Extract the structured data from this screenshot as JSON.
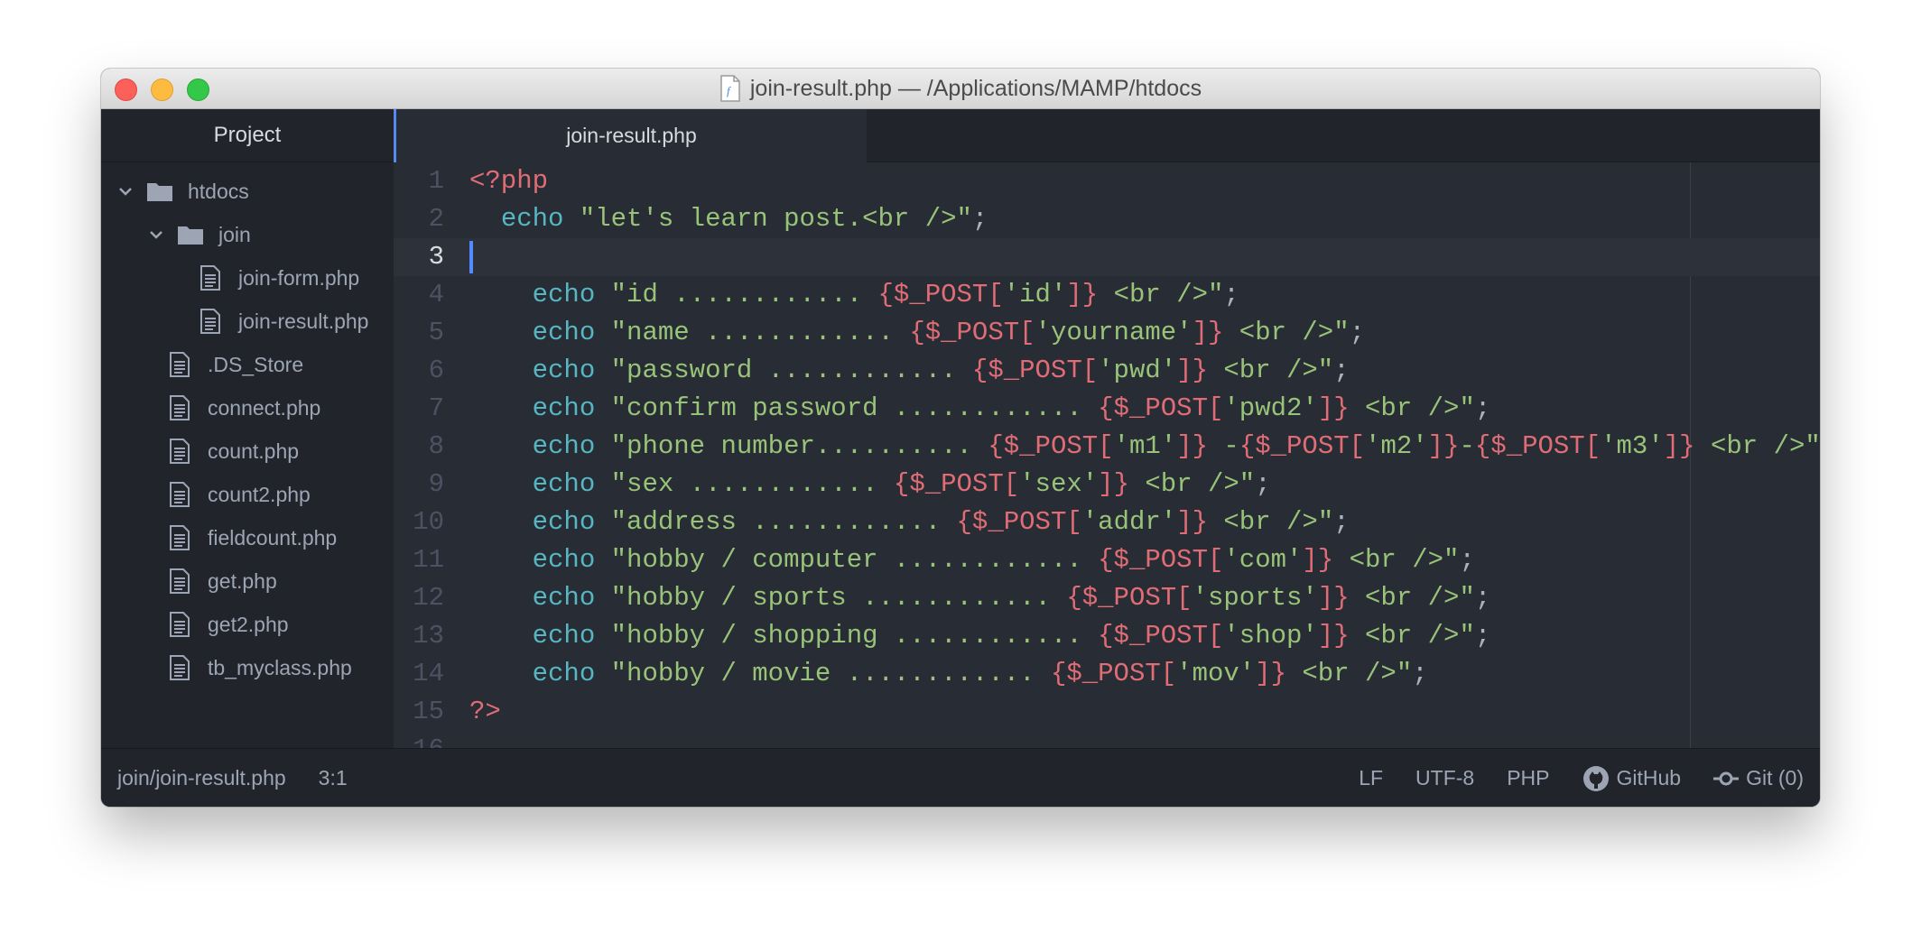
{
  "window": {
    "title": "join-result.php — /Applications/MAMP/htdocs"
  },
  "sidebar": {
    "tab_label": "Project",
    "tree": [
      {
        "label": "htdocs",
        "type": "folder",
        "depth": 0,
        "expanded": true
      },
      {
        "label": "join",
        "type": "folder",
        "depth": 1,
        "expanded": true
      },
      {
        "label": "join-form.php",
        "type": "file",
        "depth": 2
      },
      {
        "label": "join-result.php",
        "type": "file",
        "depth": 2
      },
      {
        "label": ".DS_Store",
        "type": "file",
        "depth": 1
      },
      {
        "label": "connect.php",
        "type": "file",
        "depth": 1
      },
      {
        "label": "count.php",
        "type": "file",
        "depth": 1
      },
      {
        "label": "count2.php",
        "type": "file",
        "depth": 1
      },
      {
        "label": "fieldcount.php",
        "type": "file",
        "depth": 1
      },
      {
        "label": "get.php",
        "type": "file",
        "depth": 1
      },
      {
        "label": "get2.php",
        "type": "file",
        "depth": 1
      },
      {
        "label": "tb_myclass.php",
        "type": "file",
        "depth": 1
      }
    ]
  },
  "editor": {
    "active_tab": "join-result.php",
    "cursor_line": 3,
    "lines": [
      [
        [
          "tag",
          "<?php"
        ]
      ],
      [
        [
          "pun",
          "  "
        ],
        [
          "kw",
          "echo"
        ],
        [
          "pun",
          " "
        ],
        [
          "str",
          "\"let's learn post.<br />\""
        ],
        [
          "pun",
          ";"
        ]
      ],
      [],
      [
        [
          "pun",
          "    "
        ],
        [
          "kw",
          "echo"
        ],
        [
          "pun",
          " "
        ],
        [
          "str",
          "\"id ............ "
        ],
        [
          "var",
          "{$_POST["
        ],
        [
          "str",
          "'id'"
        ],
        [
          "var",
          "]}"
        ],
        [
          "str",
          " <br />\""
        ],
        [
          "pun",
          ";"
        ]
      ],
      [
        [
          "pun",
          "    "
        ],
        [
          "kw",
          "echo"
        ],
        [
          "pun",
          " "
        ],
        [
          "str",
          "\"name ............ "
        ],
        [
          "var",
          "{$_POST["
        ],
        [
          "str",
          "'yourname'"
        ],
        [
          "var",
          "]}"
        ],
        [
          "str",
          " <br />\""
        ],
        [
          "pun",
          ";"
        ]
      ],
      [
        [
          "pun",
          "    "
        ],
        [
          "kw",
          "echo"
        ],
        [
          "pun",
          " "
        ],
        [
          "str",
          "\"password ............ "
        ],
        [
          "var",
          "{$_POST["
        ],
        [
          "str",
          "'pwd'"
        ],
        [
          "var",
          "]}"
        ],
        [
          "str",
          " <br />\""
        ],
        [
          "pun",
          ";"
        ]
      ],
      [
        [
          "pun",
          "    "
        ],
        [
          "kw",
          "echo"
        ],
        [
          "pun",
          " "
        ],
        [
          "str",
          "\"confirm password ............ "
        ],
        [
          "var",
          "{$_POST["
        ],
        [
          "str",
          "'pwd2'"
        ],
        [
          "var",
          "]}"
        ],
        [
          "str",
          " <br />\""
        ],
        [
          "pun",
          ";"
        ]
      ],
      [
        [
          "pun",
          "    "
        ],
        [
          "kw",
          "echo"
        ],
        [
          "pun",
          " "
        ],
        [
          "str",
          "\"phone number.......... "
        ],
        [
          "var",
          "{$_POST["
        ],
        [
          "str",
          "'m1'"
        ],
        [
          "var",
          "]}"
        ],
        [
          "str",
          " -"
        ],
        [
          "var",
          "{$_POST["
        ],
        [
          "str",
          "'m2'"
        ],
        [
          "var",
          "]}"
        ],
        [
          "str",
          "-"
        ],
        [
          "var",
          "{$_POST["
        ],
        [
          "str",
          "'m3'"
        ],
        [
          "var",
          "]}"
        ],
        [
          "str",
          " <br />\""
        ],
        [
          "pun",
          ";"
        ]
      ],
      [
        [
          "pun",
          "    "
        ],
        [
          "kw",
          "echo"
        ],
        [
          "pun",
          " "
        ],
        [
          "str",
          "\"sex ............ "
        ],
        [
          "var",
          "{$_POST["
        ],
        [
          "str",
          "'sex'"
        ],
        [
          "var",
          "]}"
        ],
        [
          "str",
          " <br />\""
        ],
        [
          "pun",
          ";"
        ]
      ],
      [
        [
          "pun",
          "    "
        ],
        [
          "kw",
          "echo"
        ],
        [
          "pun",
          " "
        ],
        [
          "str",
          "\"address ............ "
        ],
        [
          "var",
          "{$_POST["
        ],
        [
          "str",
          "'addr'"
        ],
        [
          "var",
          "]}"
        ],
        [
          "str",
          " <br />\""
        ],
        [
          "pun",
          ";"
        ]
      ],
      [
        [
          "pun",
          "    "
        ],
        [
          "kw",
          "echo"
        ],
        [
          "pun",
          " "
        ],
        [
          "str",
          "\"hobby / computer ............ "
        ],
        [
          "var",
          "{$_POST["
        ],
        [
          "str",
          "'com'"
        ],
        [
          "var",
          "]}"
        ],
        [
          "str",
          " <br />\""
        ],
        [
          "pun",
          ";"
        ]
      ],
      [
        [
          "pun",
          "    "
        ],
        [
          "kw",
          "echo"
        ],
        [
          "pun",
          " "
        ],
        [
          "str",
          "\"hobby / sports ............ "
        ],
        [
          "var",
          "{$_POST["
        ],
        [
          "str",
          "'sports'"
        ],
        [
          "var",
          "]}"
        ],
        [
          "str",
          " <br />\""
        ],
        [
          "pun",
          ";"
        ]
      ],
      [
        [
          "pun",
          "    "
        ],
        [
          "kw",
          "echo"
        ],
        [
          "pun",
          " "
        ],
        [
          "str",
          "\"hobby / shopping ............ "
        ],
        [
          "var",
          "{$_POST["
        ],
        [
          "str",
          "'shop'"
        ],
        [
          "var",
          "]}"
        ],
        [
          "str",
          " <br />\""
        ],
        [
          "pun",
          ";"
        ]
      ],
      [
        [
          "pun",
          "    "
        ],
        [
          "kw",
          "echo"
        ],
        [
          "pun",
          " "
        ],
        [
          "str",
          "\"hobby / movie ............ "
        ],
        [
          "var",
          "{$_POST["
        ],
        [
          "str",
          "'mov'"
        ],
        [
          "var",
          "]}"
        ],
        [
          "str",
          " <br />\""
        ],
        [
          "pun",
          ";"
        ]
      ],
      [
        [
          "tag",
          "?>"
        ]
      ],
      []
    ]
  },
  "statusbar": {
    "file_path": "join/join-result.php",
    "cursor_position": "3:1",
    "line_ending": "LF",
    "encoding": "UTF-8",
    "grammar": "PHP",
    "github_label": "GitHub",
    "git_label": "Git (0)"
  },
  "icons": {
    "folder": "folder-icon",
    "file": "file-text-icon",
    "expanded": "chevron-down-icon",
    "github": "github-icon",
    "git": "git-commit-icon",
    "title_file": "php-file-icon"
  },
  "colors": {
    "keyword": "#56b6c2",
    "string": "#98c379",
    "variable": "#e06c75",
    "tag": "#e06c75",
    "accent": "#568af2"
  }
}
